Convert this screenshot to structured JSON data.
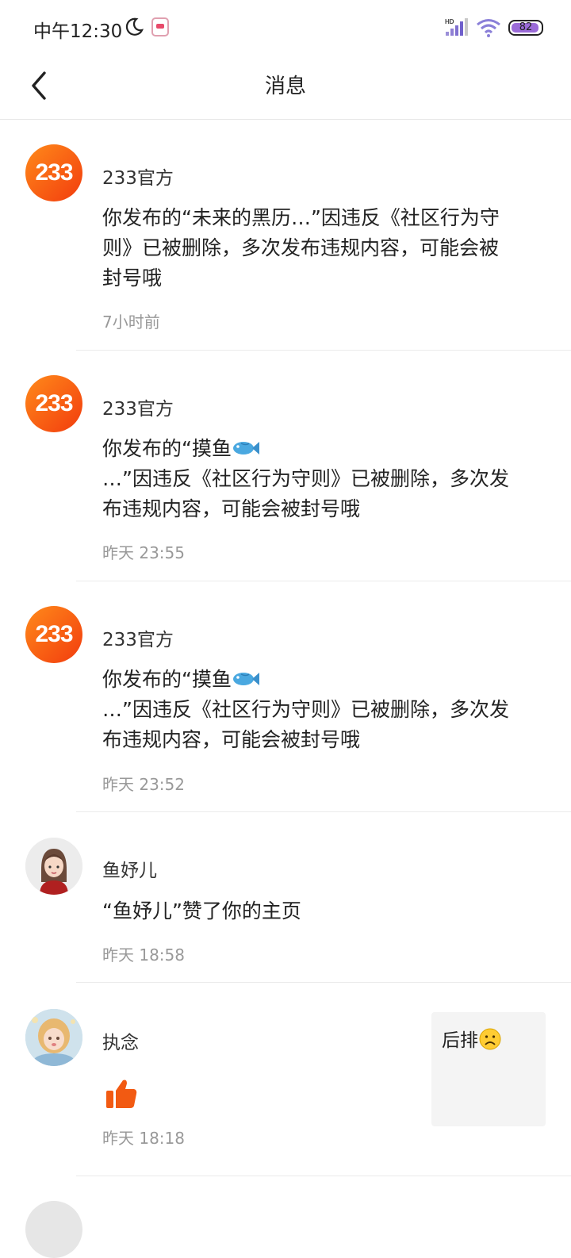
{
  "status_bar": {
    "time": "中午12:30",
    "battery": "82",
    "network": "HD"
  },
  "header": {
    "title": "消息"
  },
  "messages": [
    {
      "sender": "233官方",
      "avatar_text": "233",
      "content": "你发布的“未来的黑历…”因违反《社区行为守则》已被删除，多次发布违规内容，可能会被封号哦",
      "time": "7小时前"
    },
    {
      "sender": "233官方",
      "avatar_text": "233",
      "content_line1": "你发布的“摸鱼",
      "content_rest": "…”因违反《社区行为守则》已被删除，多次发布违规内容，可能会被封号哦",
      "emoji": "fish-icon",
      "time": "昨天 23:55"
    },
    {
      "sender": "233官方",
      "avatar_text": "233",
      "content_line1": "你发布的“摸鱼",
      "content_rest": "…”因违反《社区行为守则》已被删除，多次发布违规内容，可能会被封号哦",
      "emoji": "fish-icon",
      "time": "昨天 23:52"
    },
    {
      "sender": "鱼妤儿",
      "content": "“鱼妤儿”赞了你的主页",
      "time": "昨天 18:58"
    },
    {
      "sender": "执念",
      "icon": "thumbs-up-icon",
      "time": "昨天 18:18",
      "quote": "后排",
      "quote_emoji": "frown-icon"
    }
  ],
  "colors": {
    "brand": "#f05a14",
    "thumb": "#f25a12",
    "divider": "#ebebeb",
    "time_text": "#999999"
  }
}
